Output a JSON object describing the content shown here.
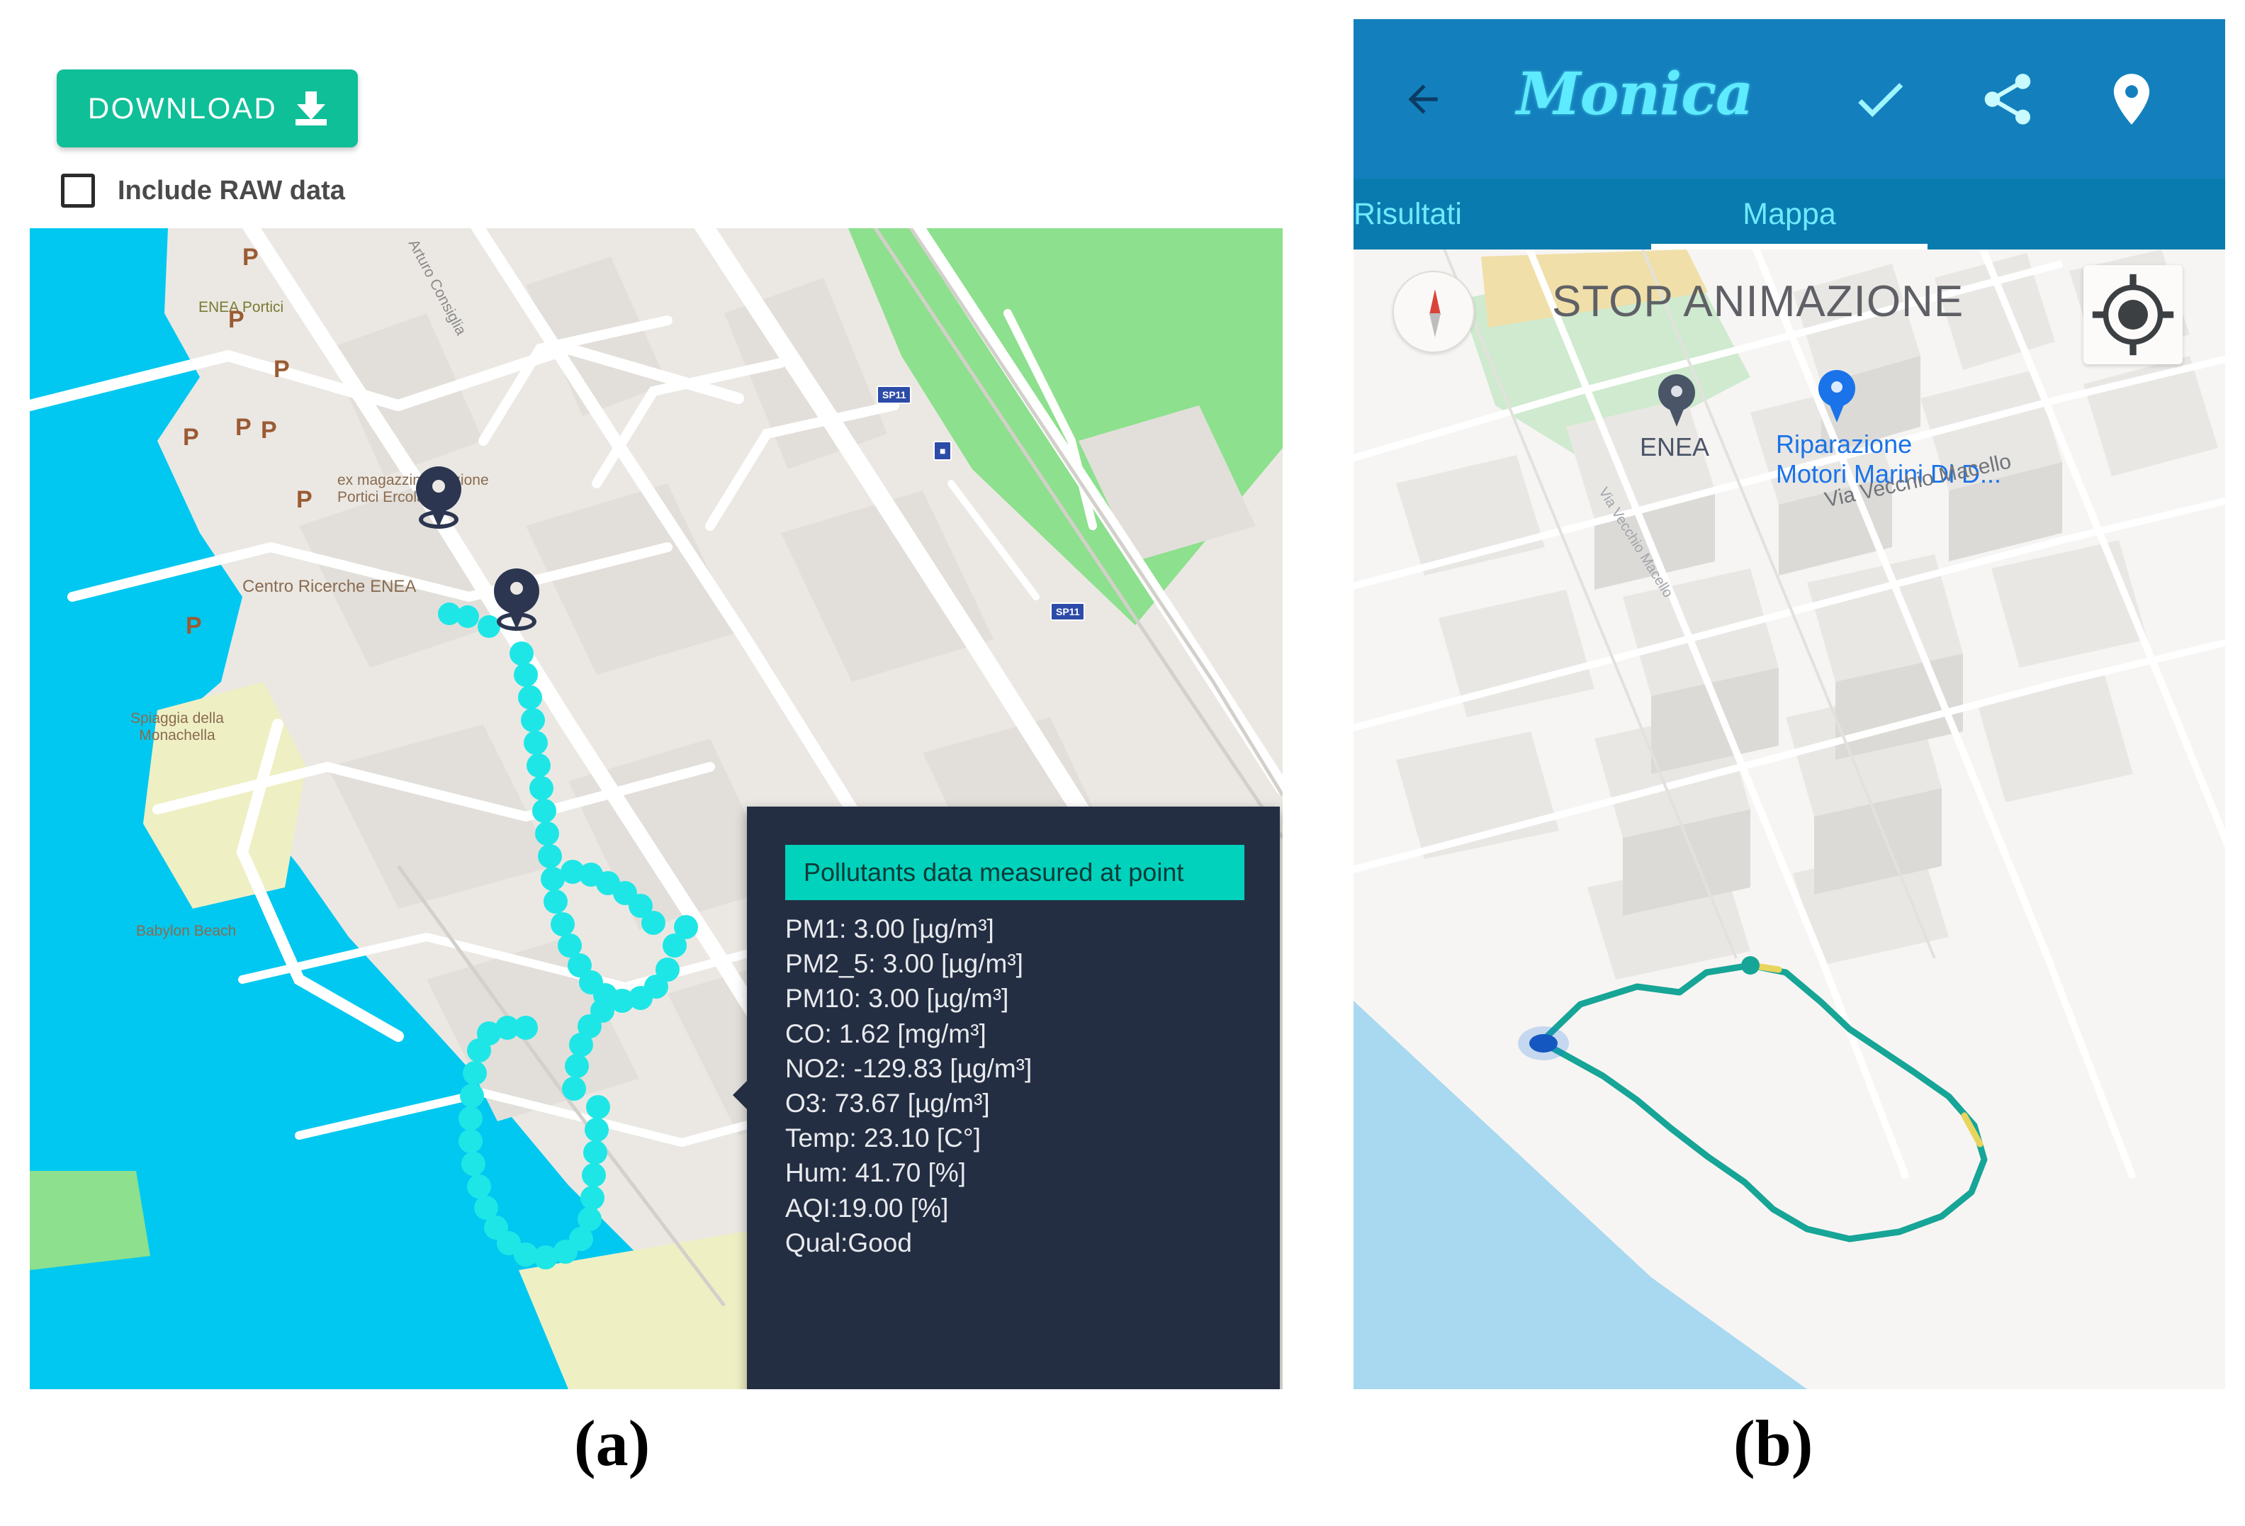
{
  "panel_a": {
    "toolbar": {
      "download_label": "DOWNLOAD",
      "download_icon": "download-icon",
      "raw_checkbox_label": "Include RAW data",
      "raw_checked": false
    },
    "map": {
      "provider_style": "osm-light",
      "sea_color": "#00C8F0",
      "land_color": "#EBE8E3",
      "park_color": "#8DE08D",
      "beach_color": "#EFEFC4",
      "track_color": "#1FE6E6",
      "labels": [
        {
          "text": "ENEA Portici",
          "color": "#7A7A33"
        },
        {
          "text": "ex magazzino stazione\nPortici Ercolano",
          "color": "#8A6B4F"
        },
        {
          "text": "Spiaggia della\nMonachella",
          "color": "#8A6B4F"
        },
        {
          "text": "Babylon Beach",
          "color": "#8A6B4F"
        },
        {
          "text": "Centro Ricerche ENEA",
          "color": "#8A6B4F"
        },
        {
          "text": "Arturo Consiglia",
          "color": "#8A8A8A"
        }
      ],
      "parking_marker": "P",
      "parking_count": 8,
      "road_shield": "SP11",
      "road_shield_count": 2,
      "pin_count": 2
    },
    "tooltip": {
      "title": "Pollutants data measured at point",
      "title_bg": "#00D2BC",
      "panel_bg": "#242E42",
      "lines": [
        "PM1: 3.00 [µg/m³]",
        "PM2_5: 3.00 [µg/m³]",
        "PM10: 3.00 [µg/m³]",
        "CO: 1.62 [mg/m³]",
        "NO2: -129.83 [µg/m³]",
        "O3: 73.67 [µg/m³]",
        "Temp: 23.10 [C°]",
        "Hum: 41.70 [%]",
        "AQI:19.00 [%]",
        "Qual:Good"
      ],
      "measurements": {
        "PM1": {
          "value": 3.0,
          "unit": "µg/m³"
        },
        "PM2_5": {
          "value": 3.0,
          "unit": "µg/m³"
        },
        "PM10": {
          "value": 3.0,
          "unit": "µg/m³"
        },
        "CO": {
          "value": 1.62,
          "unit": "mg/m³"
        },
        "NO2": {
          "value": -129.83,
          "unit": "µg/m³"
        },
        "O3": {
          "value": 73.67,
          "unit": "µg/m³"
        },
        "Temp": {
          "value": 23.1,
          "unit": "C°"
        },
        "Hum": {
          "value": 41.7,
          "unit": "%"
        },
        "AQI": {
          "value": 19.0,
          "unit": "%"
        },
        "Qual": {
          "value": "Good",
          "unit": ""
        }
      }
    }
  },
  "panel_b": {
    "appbar": {
      "back_icon": "back-arrow-icon",
      "title": "Monica",
      "title_color": "#5EEBFF",
      "bar_color": "#1380BD",
      "check_icon": "checkmark-icon",
      "share_icon": "share-icon",
      "locate_icon": "location-pin-icon"
    },
    "tabs": [
      {
        "label": "Risultati",
        "active": false
      },
      {
        "label": "Mappa",
        "active": true
      }
    ],
    "map": {
      "stop_animation_label": "STOP ANIMAZIONE",
      "compass_icon": "compass-icon",
      "my_location_icon": "my-location-icon",
      "route_color": "#16A597",
      "sea_color": "#A8D9F0",
      "markers": [
        {
          "label": "ENEA",
          "color": "#4A5568",
          "label_color": "#4A5568"
        },
        {
          "label": "Riparazione\nMotori Marini Di D...",
          "color": "#1A73E8",
          "label_color": "#1A73E8"
        }
      ],
      "streets": [
        {
          "text": "Via Vecchio Macello"
        },
        {
          "text": "Via Vecchio Macello"
        }
      ]
    }
  },
  "captions": {
    "a": "(a)",
    "b": "(b)"
  }
}
